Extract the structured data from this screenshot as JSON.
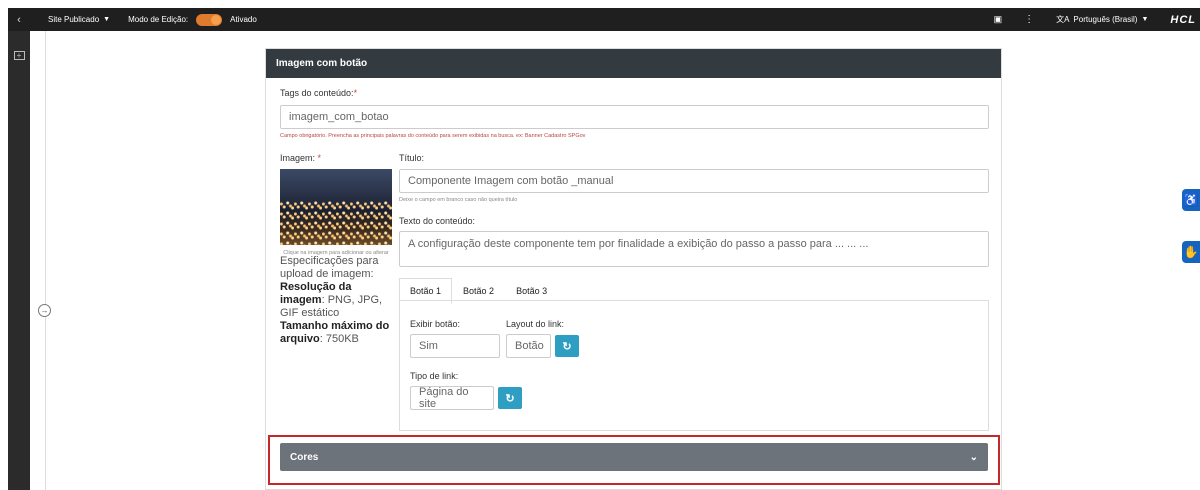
{
  "topbar": {
    "back_icon": "chevron-left-icon",
    "site_status": "Site Publicado",
    "edit_mode_label": "Modo de Edição:",
    "edit_mode_state": "Ativado",
    "language": "Português (Brasil)",
    "brand": "HCL",
    "toggle_color": "#e07a2d"
  },
  "card": {
    "title": "Imagem com botão",
    "tags_label": "Tags do conteúdo:",
    "tags_required": "*",
    "tags_value": "imagem_com_botao",
    "tags_hint": "Campo obrigatório. Preencha as principais palavras do conteúdo para serem exibidas na busca. ex: Banner Cadastro SPGov",
    "image_label": "Imagem:",
    "image_required": "*",
    "image_hint": "Clique na imagem para adicionar ou alterar",
    "title_label": "Título:",
    "title_value": "Componente Imagem com botão _manual",
    "title_hint": "Deixe o campo em branco caso não queira título",
    "content_label": "Texto do conteúdo:",
    "content_value": "A configuração deste componente tem por finalidade a exibição do passo a passo para ... ... ...",
    "spec_intro": "Especificações para upload de imagem:",
    "spec_res_label": "Resolução da imagem",
    "spec_res_value": ": PNG, JPG, GIF estático",
    "spec_size_label": "Tamanho máximo do arquivo",
    "spec_size_value": ": 750KB"
  },
  "tabs": [
    "Botão 1",
    "Botão 2",
    "Botão 3"
  ],
  "button_panel": {
    "show_label": "Exibir botão:",
    "show_value": "Sim",
    "layout_label": "Layout do link:",
    "layout_value": "Botão",
    "type_label": "Tipo de link:",
    "type_value": "Página do site"
  },
  "colors_section": {
    "label": "Cores"
  },
  "accent_color": "#2e9fc2",
  "highlight_color": "#c62828"
}
